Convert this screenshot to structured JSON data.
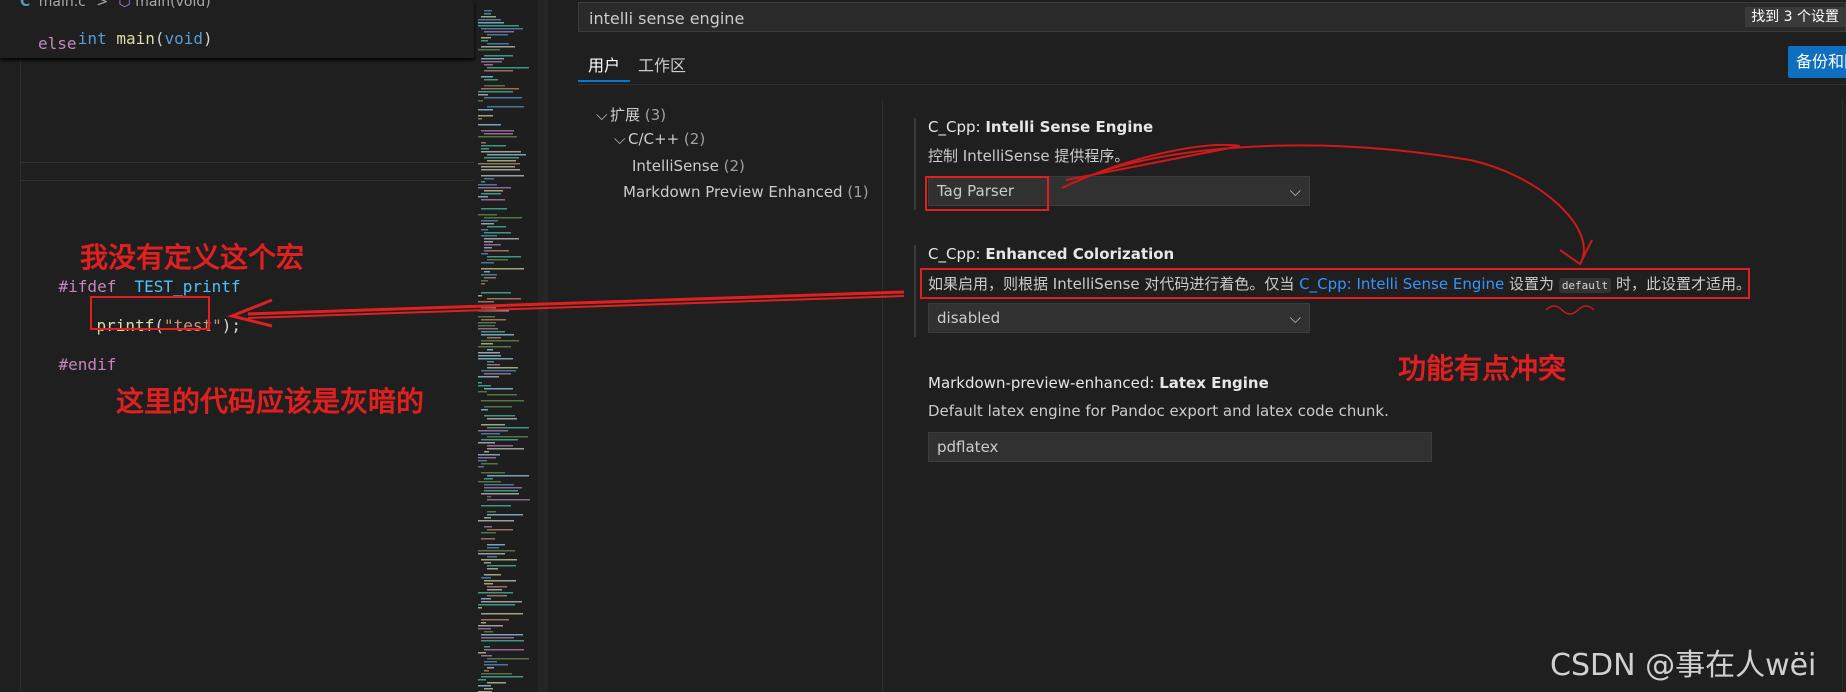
{
  "editor": {
    "breadcrumb": {
      "file_icon": "C",
      "file": "main.c",
      "separator": ">",
      "symbol_icon": "cube-icon",
      "symbol": "main(void)"
    },
    "sticky_lines": [
      {
        "type": "int",
        "name": "main",
        "rest": "(void)"
      },
      {
        "keyword": "else"
      }
    ],
    "code": {
      "ifdef": "#ifdef",
      "macro": "TEST_printf",
      "printf_fn": "printf",
      "paren_open": "(",
      "string": "\"test\"",
      "paren_close": ");",
      "endif": "#endif"
    }
  },
  "settings": {
    "search": {
      "value": "intelli sense engine",
      "result_count": "找到 3 个设置"
    },
    "tabs": [
      {
        "label": "用户"
      },
      {
        "label": "工作区"
      }
    ],
    "backup_button": "备份和同步设置",
    "toc": [
      {
        "label": "扩展",
        "count": "(3)",
        "expanded": true
      },
      {
        "label": "C/C++",
        "count": "(2)",
        "expanded": true
      },
      {
        "label": "IntelliSense",
        "count": "(2)"
      },
      {
        "label": "Markdown Preview Enhanced",
        "count": "(1)"
      }
    ],
    "items": [
      {
        "category": "C_Cpp: ",
        "name": "Intelli Sense Engine",
        "description": "控制 IntelliSense 提供程序。",
        "value": "Tag Parser"
      },
      {
        "category": "C_Cpp: ",
        "name": "Enhanced Colorization",
        "desc_part1": "如果启用，则根据 IntelliSense 对代码进行着色。仅当 ",
        "desc_link": "C_Cpp: Intelli Sense Engine",
        "desc_part2": " 设置为 ",
        "desc_code": "default",
        "desc_part3": " 时，此设置才适用。",
        "value": "disabled"
      },
      {
        "category": "Markdown-preview-enhanced: ",
        "name": "Latex Engine",
        "description": "Default latex engine for Pandoc export and latex code chunk.",
        "value": "pdflatex"
      }
    ]
  },
  "annotations": {
    "no_macro": "我没有定义这个宏",
    "should_be_dim": "这里的代码应该是灰暗的",
    "conflict": "功能有点冲突",
    "color": "#e02020"
  },
  "watermark": "CSDN @事在人wëi",
  "icons": {
    "chevron": "chevron-down-icon",
    "select_arrow": "chevron-down-icon"
  }
}
